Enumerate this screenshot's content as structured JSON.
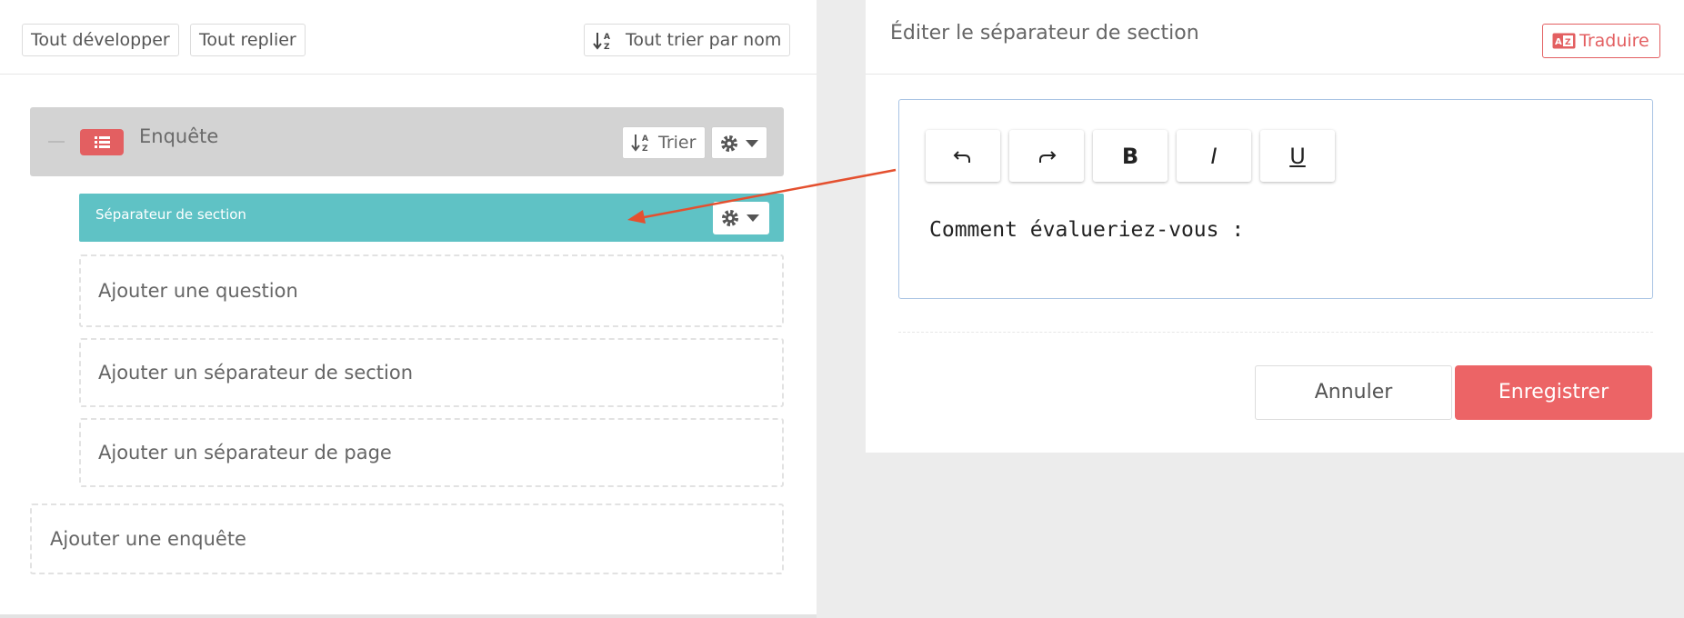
{
  "toolbar": {
    "expand_all": "Tout développer",
    "collapse_all": "Tout replier",
    "sort_all": "Tout trier par nom"
  },
  "survey": {
    "title": "Enquête",
    "sort_label": "Trier",
    "icon": "list-icon"
  },
  "section": {
    "label": "Séparateur de section"
  },
  "add_actions": {
    "question": "Ajouter une question",
    "section_separator": "Ajouter un séparateur de section",
    "page_separator": "Ajouter un séparateur de page",
    "survey": "Ajouter une enquête"
  },
  "editor_panel": {
    "title": "Éditer le séparateur de section",
    "translate": "Traduire",
    "toolbar": {
      "undo": "undo-icon",
      "redo": "redo-icon",
      "bold": "B",
      "italic": "I",
      "underline": "U"
    },
    "content": "Comment évalueriez-vous :",
    "cancel": "Annuler",
    "save": "Enregistrer"
  },
  "colors": {
    "accent": "#ec6466",
    "section": "#5fc2c5",
    "annotation_arrow": "#e4502f"
  }
}
